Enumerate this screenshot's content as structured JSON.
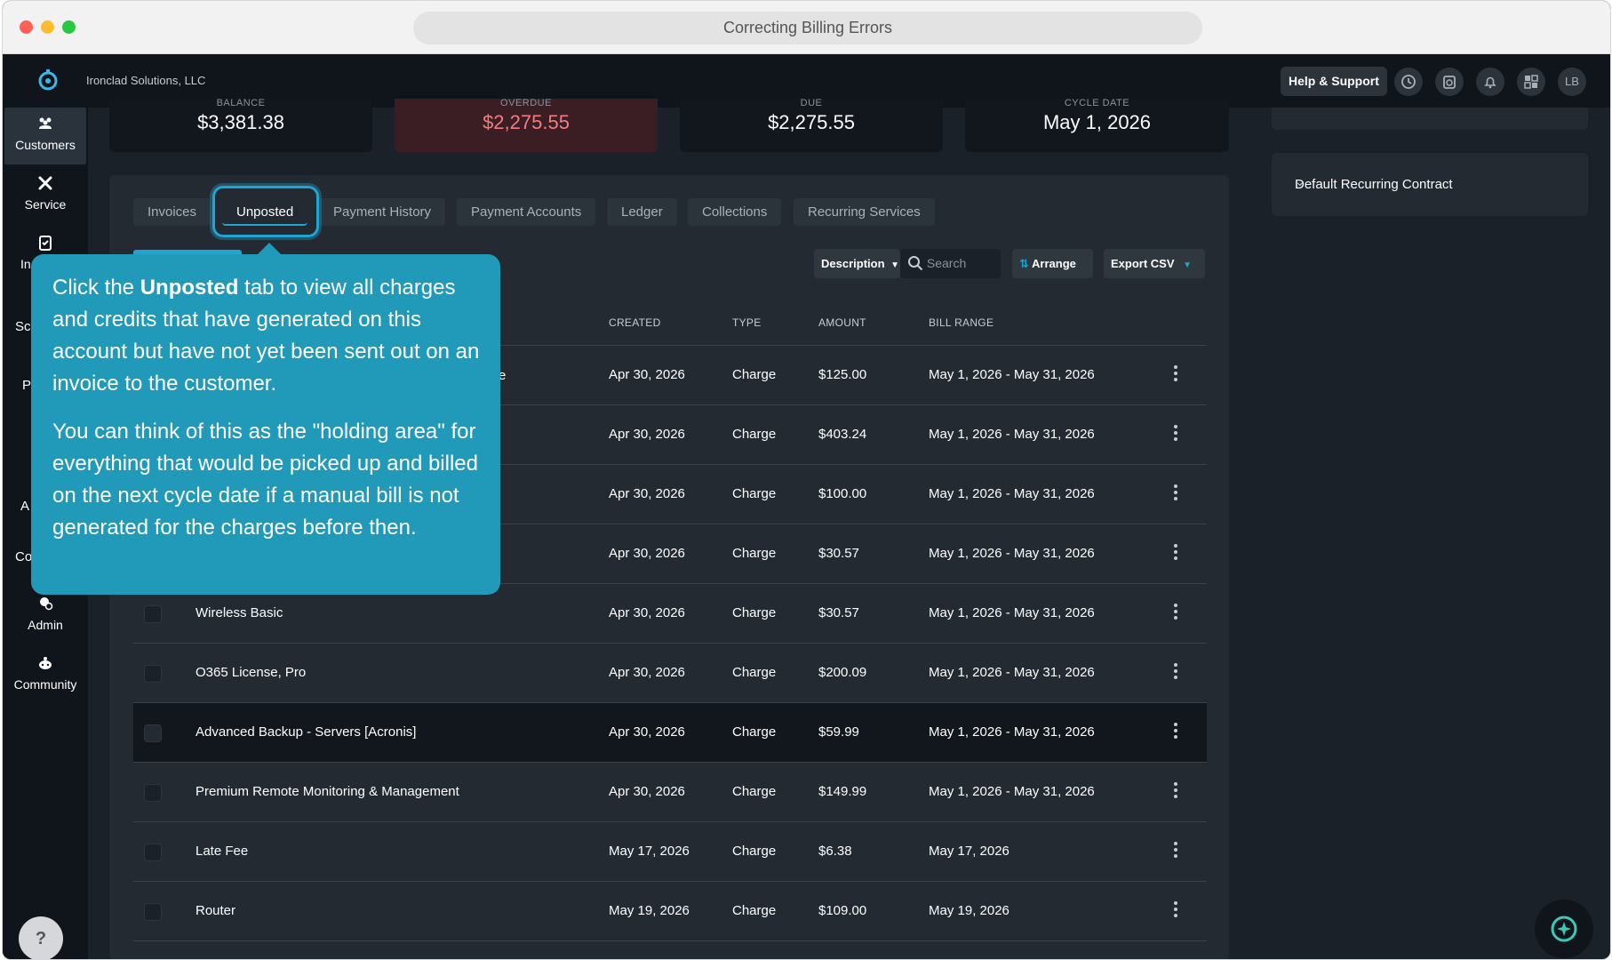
{
  "browser": {
    "title": "Correcting Billing Errors"
  },
  "header": {
    "company": "Ironclad Solutions, LLC",
    "help_label": "Help & Support",
    "avatar_initials": "LB"
  },
  "sidebar": {
    "items": [
      {
        "label": "Customers",
        "icon": "customers-icon"
      },
      {
        "label": "Service",
        "icon": "service-icon"
      },
      {
        "label": "In",
        "icon": "clipboard-icon"
      },
      {
        "label": "Sc"
      },
      {
        "label": "P"
      },
      {
        "label": "A"
      },
      {
        "label": "Co"
      },
      {
        "label": "Admin",
        "icon": "admin-icon"
      },
      {
        "label": "Community",
        "icon": "community-icon"
      }
    ],
    "help_glyph": "?"
  },
  "stats": [
    {
      "label": "BALANCE",
      "value": "$3,381.38"
    },
    {
      "label": "OVERDUE",
      "value": "$2,275.55"
    },
    {
      "label": "DUE",
      "value": "$2,275.55"
    },
    {
      "label": "CYCLE DATE",
      "value": "May 1, 2026"
    }
  ],
  "tabs": [
    "Invoices",
    "Unposted",
    "Payment History",
    "Payment Accounts",
    "Ledger",
    "Collections",
    "Recurring Services"
  ],
  "toolbar": {
    "sort_field": "Description",
    "search_placeholder": "Search",
    "arrange_label": "Arrange",
    "export_label": "Export CSV"
  },
  "table": {
    "columns": [
      "CREATED",
      "TYPE",
      "AMOUNT",
      "BILL RANGE"
    ],
    "rows": [
      {
        "description": "",
        "created": "Apr 30, 2026",
        "type": "Charge",
        "amount": "$125.00",
        "range": "May 1, 2026 - May 31, 2026"
      },
      {
        "description": "",
        "created": "Apr 30, 2026",
        "type": "Charge",
        "amount": "$403.24",
        "range": "May 1, 2026 - May 31, 2026"
      },
      {
        "description": "",
        "created": "Apr 30, 2026",
        "type": "Charge",
        "amount": "$100.00",
        "range": "May 1, 2026 - May 31, 2026"
      },
      {
        "description": "",
        "created": "Apr 30, 2026",
        "type": "Charge",
        "amount": "$30.57",
        "range": "May 1, 2026 - May 31, 2026"
      },
      {
        "description": "Wireless Basic",
        "created": "Apr 30, 2026",
        "type": "Charge",
        "amount": "$30.57",
        "range": "May 1, 2026 - May 31, 2026"
      },
      {
        "description": "O365 License, Pro",
        "created": "Apr 30, 2026",
        "type": "Charge",
        "amount": "$200.09",
        "range": "May 1, 2026 - May 31, 2026"
      },
      {
        "description": "Advanced Backup - Servers [Acronis]",
        "created": "Apr 30, 2026",
        "type": "Charge",
        "amount": "$59.99",
        "range": "May 1, 2026 - May 31, 2026"
      },
      {
        "description": "Premium Remote Monitoring & Management",
        "created": "Apr 30, 2026",
        "type": "Charge",
        "amount": "$149.99",
        "range": "May 1, 2026 - May 31, 2026"
      },
      {
        "description": "Late Fee",
        "created": "May 17, 2026",
        "type": "Charge",
        "amount": "$6.38",
        "range": "May 17, 2026"
      },
      {
        "description": "Router",
        "created": "May 19, 2026",
        "type": "Charge",
        "amount": "$109.00",
        "range": "May 19, 2026"
      }
    ],
    "obscured_fragment": "e"
  },
  "right_panel": {
    "contract_label": "Default Recurring Contract"
  },
  "tooltip": {
    "p1_before": "Click the ",
    "p1_bold": "Unposted",
    "p1_after": " tab to view all charges and credits that have generated on this account but have not yet been sent out on an invoice to the customer.",
    "p2": "You can think of this as the \"holding area\" for everything that would be picked up and billed on the next cycle date if a manual bill is not generated for the charges before then."
  },
  "colors": {
    "accent": "#22a4d1",
    "tooltip_bg": "#2199b9",
    "overdue": "#f27c82"
  }
}
